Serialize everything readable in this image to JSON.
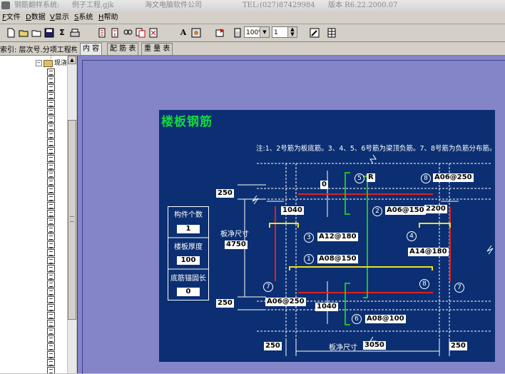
{
  "window": {
    "title_app": "钢筋翻样系统:",
    "title_project": "例子工程.gjk",
    "title_company": "海文电脑软件公司",
    "title_tel": "TEL:(027)87429984",
    "title_version": "版本 R6.22.2000.07"
  },
  "menu": [
    {
      "accel": "F",
      "label": "文件"
    },
    {
      "accel": "D",
      "label": "数据"
    },
    {
      "accel": "V",
      "label": "显示"
    },
    {
      "accel": "S",
      "label": "系统"
    },
    {
      "accel": "H",
      "label": "帮助"
    }
  ],
  "toolbar": {
    "zoom": "100%",
    "page": "1"
  },
  "index": {
    "label": "索引: 层次号.分项工程构件"
  },
  "tabs": [
    {
      "label": "内 容"
    },
    {
      "label": "配 筋 表"
    },
    {
      "label": "重 量 表"
    }
  ],
  "tree": {
    "root_label": "现浇"
  },
  "drawing": {
    "title": "楼板钢筋",
    "note": "注:1、2号筋为板底筋。3、4、5、6号筋为梁顶负筋。7、8号筋为负筋分布筋。",
    "table": [
      {
        "caption": "构件个数",
        "value": "1"
      },
      {
        "caption": "楼板厚度",
        "value": "100"
      },
      {
        "caption": "底筋锚固长",
        "value": "0"
      }
    ],
    "net_size_label_v": "板净尺寸",
    "net_size_value_v": "4750",
    "net_size_label_h": "板净尺寸",
    "net_size_value_h": "3050",
    "dims": {
      "top_250": "250",
      "bottom_250": "250",
      "left_250": "250",
      "right_250": "250",
      "top_0": "0",
      "left_1040": "1040",
      "bottom_1040": "1040",
      "right_2200": "2200"
    },
    "bars": [
      {
        "num": "1",
        "label": "A08@150"
      },
      {
        "num": "2",
        "label": "A06@150"
      },
      {
        "num": "3",
        "label": "A12@180"
      },
      {
        "num": "4",
        "label": "A14@180"
      },
      {
        "num": "5",
        "label": "R"
      },
      {
        "num": "6",
        "label": "A08@100"
      },
      {
        "num": "7",
        "label": "A06@250"
      },
      {
        "num": "8",
        "label": "A06@250"
      }
    ],
    "extra_marks": {
      "seven_right": "7",
      "eight_lower": "8"
    },
    "colors": {
      "background": "#0b2f72",
      "title": "#10d840",
      "bar_red": "#e02020",
      "bar_green": "#20c020",
      "bar_yellow": "#f0e020",
      "dashed": "#ffffff"
    }
  }
}
